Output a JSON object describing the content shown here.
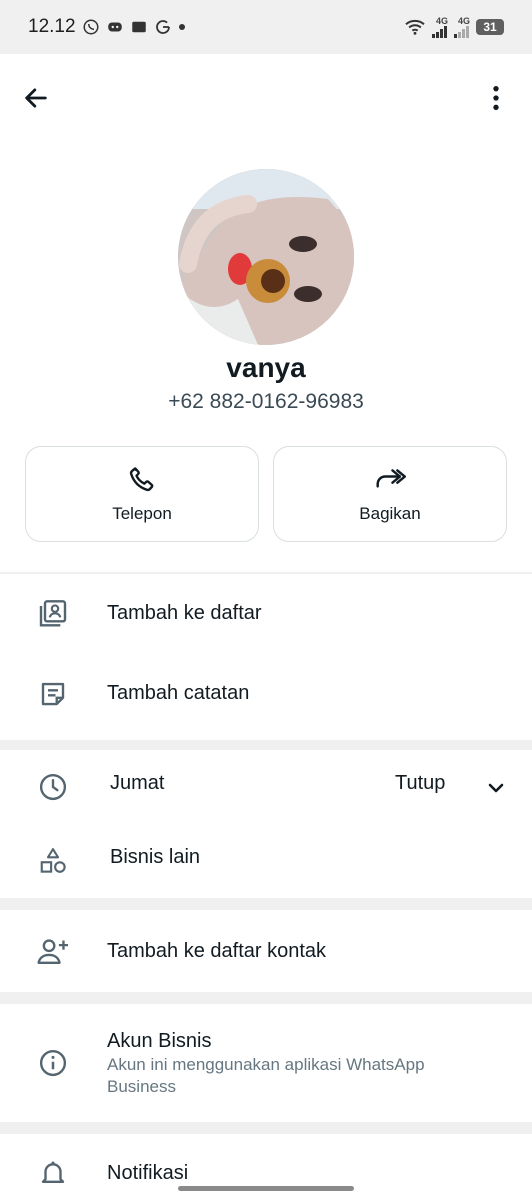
{
  "status_bar": {
    "time": "12.12",
    "net1": "4G",
    "net2": "4G",
    "battery": "31"
  },
  "profile": {
    "name": "vanya",
    "phone": "+62 882-0162-96983"
  },
  "actions": {
    "call_label": "Telepon",
    "share_label": "Bagikan"
  },
  "list1": {
    "add_to_list": "Tambah ke daftar",
    "add_note": "Tambah catatan"
  },
  "business": {
    "day": "Jumat",
    "status": "Tutup",
    "other_business": "Bisnis lain"
  },
  "contact": {
    "add_contact": "Tambah ke daftar kontak"
  },
  "account": {
    "title": "Akun Bisnis",
    "subtitle": "Akun ini menggunakan aplikasi WhatsApp Business"
  },
  "notifications": {
    "label": "Notifikasi"
  },
  "colors": {
    "background": "#f0f0f0",
    "card": "#ffffff",
    "icon": "#54656f",
    "text": "#111b21",
    "subtext": "#667781"
  }
}
